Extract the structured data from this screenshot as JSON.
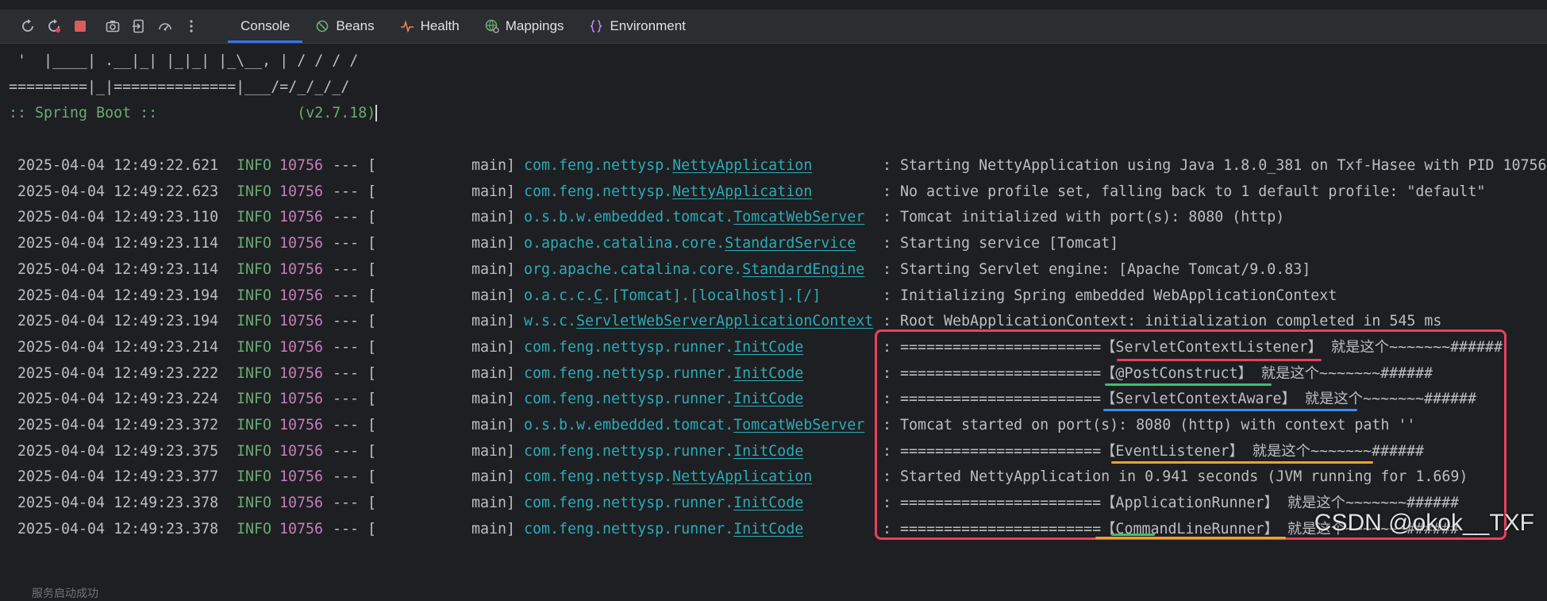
{
  "toolbar": {
    "icons": [
      "rerun-icon",
      "rerun-failed-icon",
      "stop-icon",
      "camera-icon",
      "exit-icon",
      "speedometer-icon",
      "more-icon"
    ],
    "tabs": [
      {
        "label": "Console",
        "icon": "",
        "active": true
      },
      {
        "label": "Beans",
        "icon": "beans-icon",
        "active": false
      },
      {
        "label": "Health",
        "icon": "health-icon",
        "active": false
      },
      {
        "label": "Mappings",
        "icon": "mappings-icon",
        "active": false
      },
      {
        "label": "Environment",
        "icon": "environment-icon",
        "active": false
      }
    ]
  },
  "banner": {
    "line1": "  '  |____| .__|_| |_|_| |_\\__, | / / / /",
    "line2": " =========|_|==============|___/=/_/_/_/",
    "line3": " :: Spring Boot ::                (v2.7.18)"
  },
  "logs": [
    {
      "ts": "2025-04-04 12:49:22.621",
      "level": "INFO",
      "pid": "10756",
      "sep": "--- [",
      "thread": "main]",
      "logger_prefix": "com.feng.nettysp.",
      "logger_class": "NettyApplication",
      "message": ": Starting NettyApplication using Java 1.8.0_381 on Txf-Hasee with PID 10756"
    },
    {
      "ts": "2025-04-04 12:49:22.623",
      "level": "INFO",
      "pid": "10756",
      "sep": "--- [",
      "thread": "main]",
      "logger_prefix": "com.feng.nettysp.",
      "logger_class": "NettyApplication",
      "message": ": No active profile set, falling back to 1 default profile: \"default\""
    },
    {
      "ts": "2025-04-04 12:49:23.110",
      "level": "INFO",
      "pid": "10756",
      "sep": "--- [",
      "thread": "main]",
      "logger_prefix": "o.s.b.w.embedded.tomcat.",
      "logger_class": "TomcatWebServer",
      "message": ": Tomcat initialized with port(s): 8080 (http)"
    },
    {
      "ts": "2025-04-04 12:49:23.114",
      "level": "INFO",
      "pid": "10756",
      "sep": "--- [",
      "thread": "main]",
      "logger_prefix": "o.apache.catalina.core.",
      "logger_class": "StandardService",
      "message": ": Starting service [Tomcat]"
    },
    {
      "ts": "2025-04-04 12:49:23.114",
      "level": "INFO",
      "pid": "10756",
      "sep": "--- [",
      "thread": "main]",
      "logger_prefix": "org.apache.catalina.core.",
      "logger_class": "StandardEngine",
      "message": ": Starting Servlet engine: [Apache Tomcat/9.0.83]"
    },
    {
      "ts": "2025-04-04 12:49:23.194",
      "level": "INFO",
      "pid": "10756",
      "sep": "--- [",
      "thread": "main]",
      "logger_prefix": "o.a.c.c.",
      "logger_class": "C",
      "logger_suffix": ".[Tomcat].[localhost].[/]",
      "message": ": Initializing Spring embedded WebApplicationContext"
    },
    {
      "ts": "2025-04-04 12:49:23.194",
      "level": "INFO",
      "pid": "10756",
      "sep": "--- [",
      "thread": "main]",
      "logger_prefix": "w.s.c.",
      "logger_class": "ServletWebServerApplicationContext",
      "message": ": Root WebApplicationContext: initialization completed in 545 ms"
    },
    {
      "ts": "2025-04-04 12:49:23.214",
      "level": "INFO",
      "pid": "10756",
      "sep": "--- [",
      "thread": "main]",
      "logger_prefix": "com.feng.nettysp.runner.",
      "logger_class": "InitCode",
      "message": ": =======================【ServletContextListener】 就是这个~~~~~~~######"
    },
    {
      "ts": "2025-04-04 12:49:23.222",
      "level": "INFO",
      "pid": "10756",
      "sep": "--- [",
      "thread": "main]",
      "logger_prefix": "com.feng.nettysp.runner.",
      "logger_class": "InitCode",
      "message": ": =======================【@PostConstruct】 就是这个~~~~~~~######"
    },
    {
      "ts": "2025-04-04 12:49:23.224",
      "level": "INFO",
      "pid": "10756",
      "sep": "--- [",
      "thread": "main]",
      "logger_prefix": "com.feng.nettysp.runner.",
      "logger_class": "InitCode",
      "message": ": =======================【ServletContextAware】 就是这个~~~~~~~######"
    },
    {
      "ts": "2025-04-04 12:49:23.372",
      "level": "INFO",
      "pid": "10756",
      "sep": "--- [",
      "thread": "main]",
      "logger_prefix": "o.s.b.w.embedded.tomcat.",
      "logger_class": "TomcatWebServer",
      "message": ": Tomcat started on port(s): 8080 (http) with context path ''"
    },
    {
      "ts": "2025-04-04 12:49:23.375",
      "level": "INFO",
      "pid": "10756",
      "sep": "--- [",
      "thread": "main]",
      "logger_prefix": "com.feng.nettysp.runner.",
      "logger_class": "InitCode",
      "message": ": =======================【EventListener】 就是这个~~~~~~~######"
    },
    {
      "ts": "2025-04-04 12:49:23.377",
      "level": "INFO",
      "pid": "10756",
      "sep": "--- [",
      "thread": "main]",
      "logger_prefix": "com.feng.nettysp.",
      "logger_class": "NettyApplication",
      "message": ": Started NettyApplication in 0.941 seconds (JVM running for 1.669)"
    },
    {
      "ts": "2025-04-04 12:49:23.378",
      "level": "INFO",
      "pid": "10756",
      "sep": "--- [",
      "thread": "main]",
      "logger_prefix": "com.feng.nettysp.runner.",
      "logger_class": "InitCode",
      "message": ": =======================【ApplicationRunner】 就是这个~~~~~~~######"
    },
    {
      "ts": "2025-04-04 12:49:23.378",
      "level": "INFO",
      "pid": "10756",
      "sep": "--- [",
      "thread": "main]",
      "logger_prefix": "com.feng.nettysp.runner.",
      "logger_class": "InitCode",
      "message": ": =======================【CommandLineRunner】 就是这个~~~~~~~######"
    }
  ],
  "bottom_partial": "服务启动成功",
  "watermark": "CSDN @okok__TXF",
  "colors": {
    "background": "#1e1f22",
    "toolbar": "#2b2d30",
    "accent": "#3574f0",
    "info": "#6aab73",
    "pid": "#c77dbb",
    "logger": "#2aacb8",
    "highlight_box": "#e8415d",
    "underline_red": "#e8415d",
    "underline_green": "#3fc06a",
    "underline_blue": "#3b8ef0",
    "underline_orange": "#f0a030"
  }
}
